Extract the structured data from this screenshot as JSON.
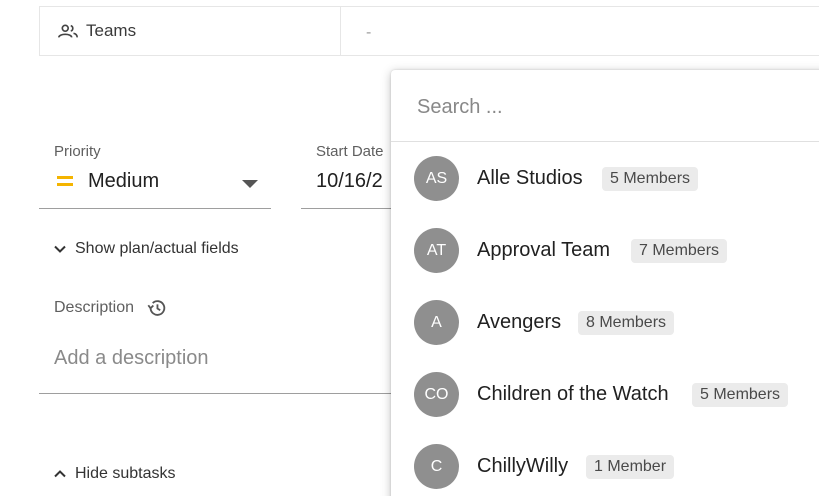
{
  "teams_field": {
    "label": "Teams",
    "value": "-"
  },
  "priority": {
    "label": "Priority",
    "value": "Medium",
    "color": "#f4b400"
  },
  "start_date": {
    "label": "Start Date",
    "value": "10/16/2"
  },
  "plan_toggle": {
    "label": "Show plan/actual fields"
  },
  "description": {
    "label": "Description",
    "placeholder": "Add a description"
  },
  "subtasks_toggle": {
    "label": "Hide subtasks"
  },
  "dropdown": {
    "search_placeholder": "Search ...",
    "items": [
      {
        "initials": "AS",
        "name": "Alle Studios",
        "members": "5 Members"
      },
      {
        "initials": "AT",
        "name": "Approval Team",
        "members": "7 Members"
      },
      {
        "initials": "A",
        "name": "Avengers",
        "members": "8 Members"
      },
      {
        "initials": "CO",
        "name": "Children of the Watch",
        "members": "5 Members"
      },
      {
        "initials": "C",
        "name": "ChillyWilly",
        "members": "1 Member"
      }
    ]
  }
}
